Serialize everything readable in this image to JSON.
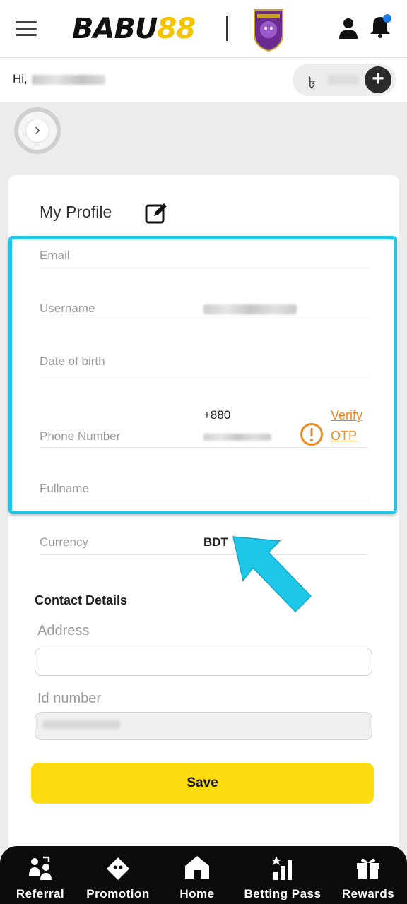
{
  "header": {
    "logo_text_main": "BABU",
    "logo_text_accent": "88"
  },
  "greeting": {
    "prefix": "Hi,",
    "currency_symbol": "৳"
  },
  "profile": {
    "title": "My Profile",
    "fields": {
      "email_label": "Email",
      "username_label": "Username",
      "dob_label": "Date of birth",
      "phone_label": "Phone Number",
      "phone_prefix": "+880",
      "verify_label": "Verify",
      "otp_label": "OTP",
      "fullname_label": "Fullname",
      "currency_label": "Currency",
      "currency_value": "BDT"
    }
  },
  "contact": {
    "title": "Contact Details",
    "address_label": "Address",
    "address_value": "",
    "id_label": "Id number"
  },
  "actions": {
    "save_label": "Save"
  },
  "nav": {
    "items": [
      {
        "label": "Referral",
        "icon": "referral-icon"
      },
      {
        "label": "Promotion",
        "icon": "ticket-icon"
      },
      {
        "label": "Home",
        "icon": "home-icon"
      },
      {
        "label": "Betting Pass",
        "icon": "chart-star-icon"
      },
      {
        "label": "Rewards",
        "icon": "gift-icon"
      }
    ]
  },
  "colors": {
    "accent_yellow": "#fddc12",
    "highlight_cyan": "#1ec7e8",
    "verify_orange": "#f08a1e",
    "nav_bg": "#0b0b0b"
  }
}
